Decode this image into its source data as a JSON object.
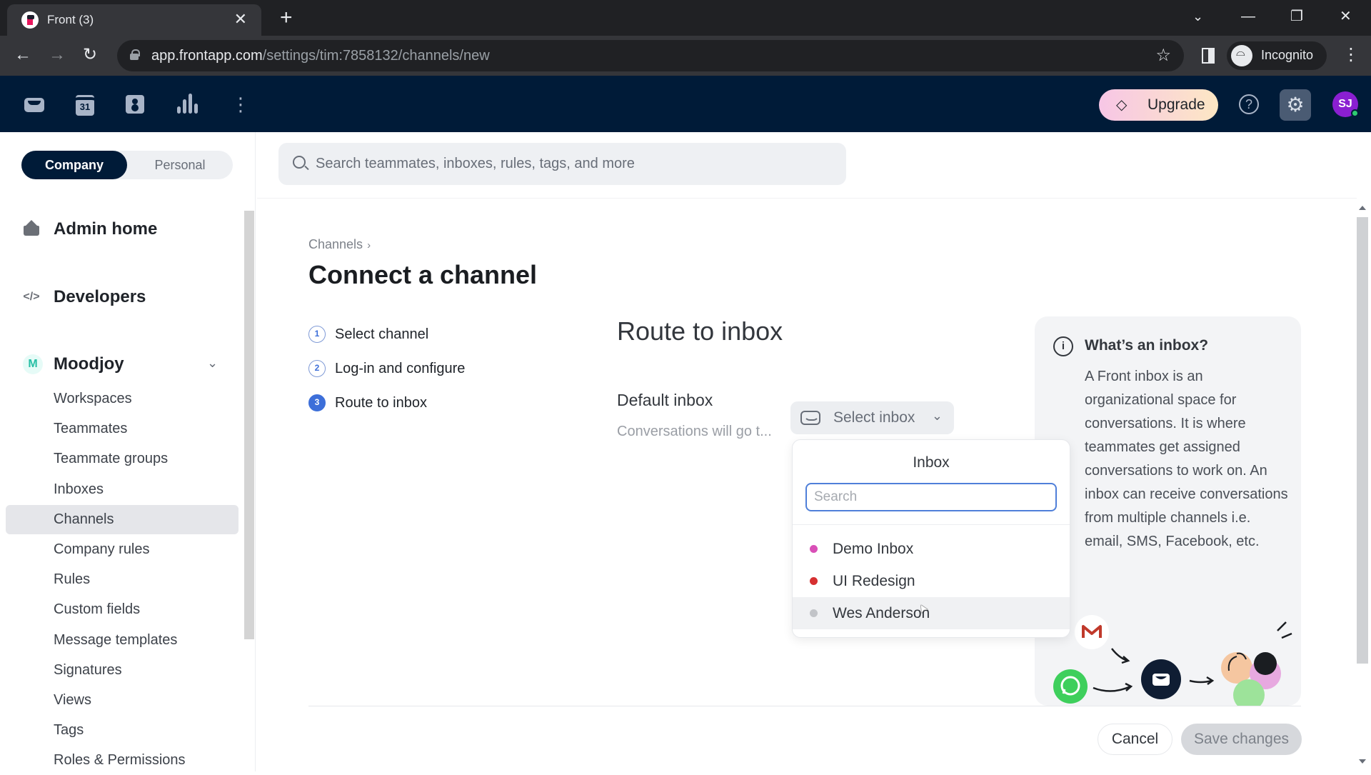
{
  "browser": {
    "tab_title": "Front (3)",
    "url_host": "app.frontapp.com",
    "url_path": "/settings/tim:7858132/channels/new",
    "profile_label": "Incognito"
  },
  "appbar": {
    "upgrade_label": "Upgrade",
    "avatar_initials": "SJ",
    "calendar_day": "31",
    "colors": {
      "background": "#001b38",
      "avatar": "#8a1fd1"
    }
  },
  "sidebar": {
    "segments": {
      "company": "Company",
      "personal": "Personal",
      "active": "Company"
    },
    "admin_home": "Admin home",
    "developers": "Developers",
    "workspace": {
      "badge": "M",
      "name": "Moodjoy"
    },
    "items": [
      {
        "label": "Workspaces"
      },
      {
        "label": "Teammates"
      },
      {
        "label": "Teammate groups"
      },
      {
        "label": "Inboxes"
      },
      {
        "label": "Channels",
        "active": true
      },
      {
        "label": "Company rules"
      },
      {
        "label": "Rules"
      },
      {
        "label": "Custom fields"
      },
      {
        "label": "Message templates"
      },
      {
        "label": "Signatures"
      },
      {
        "label": "Views"
      },
      {
        "label": "Tags"
      },
      {
        "label": "Roles & Permissions"
      }
    ]
  },
  "search": {
    "placeholder": "Search teammates, inboxes, rules, tags, and more",
    "value": ""
  },
  "main": {
    "breadcrumb": "Channels",
    "title": "Connect a channel",
    "steps": [
      {
        "num": "1",
        "label": "Select channel"
      },
      {
        "num": "2",
        "label": "Log-in and configure"
      },
      {
        "num": "3",
        "label": "Route to inbox",
        "current": true
      }
    ],
    "route_title": "Route to inbox",
    "default_inbox_label": "Default inbox",
    "default_inbox_desc": "Conversations will go t...",
    "select_placeholder": "Select inbox",
    "dropdown": {
      "title": "Inbox",
      "search_placeholder": "Search",
      "search_value": "",
      "options": [
        {
          "label": "Demo Inbox",
          "color": "#d94fb7"
        },
        {
          "label": "UI Redesign",
          "color": "#d63031"
        },
        {
          "label": "Wes Anderson",
          "color": "#c2c4c8",
          "hovered": true
        }
      ]
    },
    "info": {
      "title": "What’s an inbox?",
      "body": "A Front inbox is an organizational space for conversations. It is where teammates get assigned conversations to work on. An inbox can receive conversations from multiple channels i.e. email, SMS, Facebook, etc."
    },
    "cancel_label": "Cancel",
    "save_label": "Save changes",
    "accent_color": "#3d6fd9"
  }
}
